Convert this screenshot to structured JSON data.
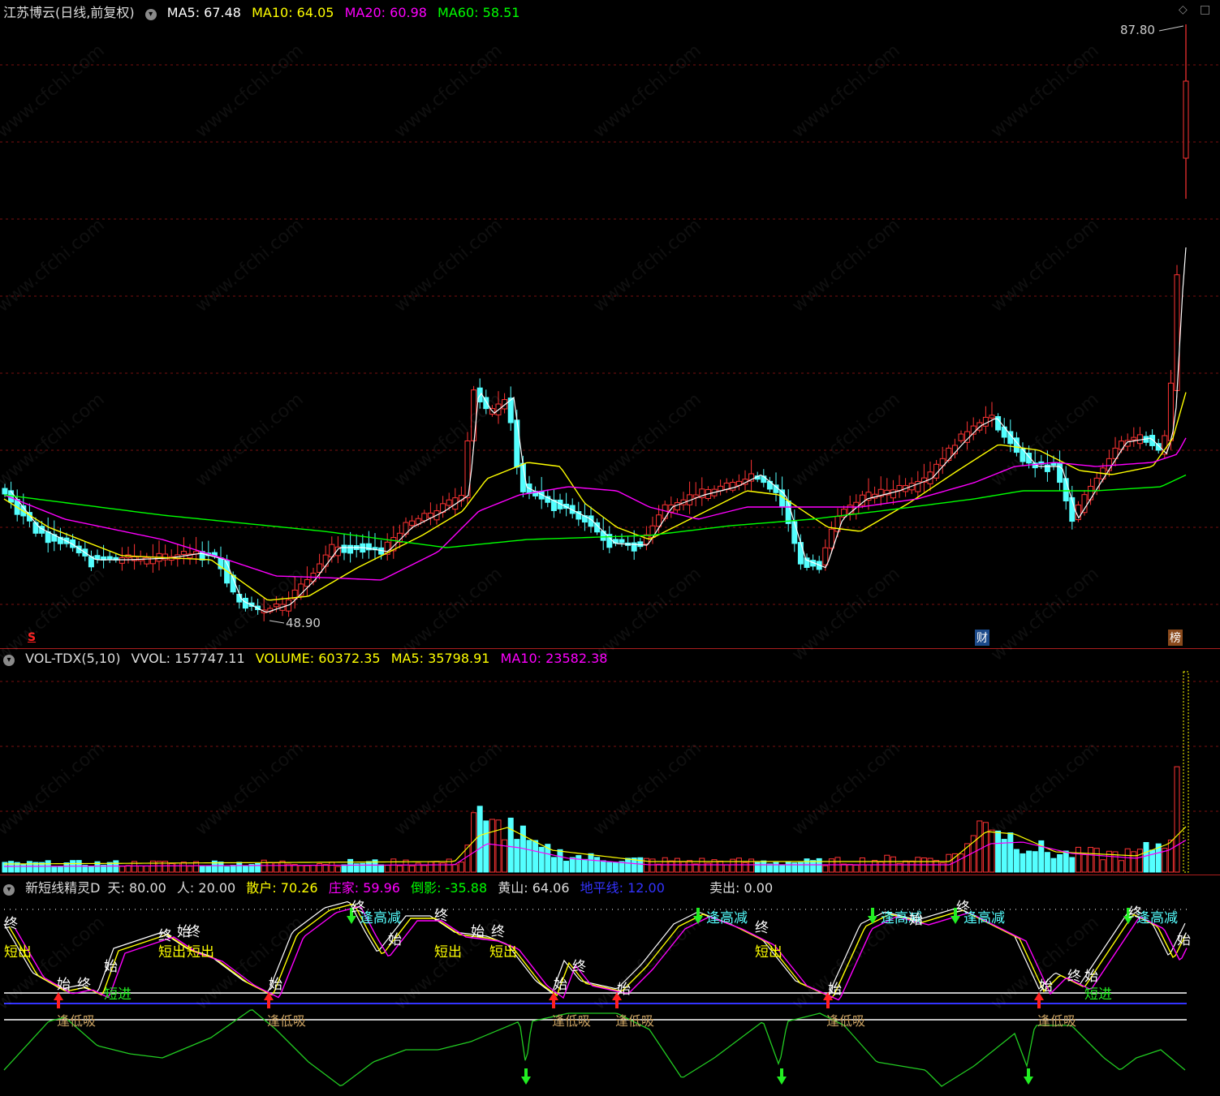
{
  "price_panel": {
    "title": "江苏博云(日线,前复权)",
    "ma": [
      {
        "label": "MA5: 67.48",
        "color": "#ffffff"
      },
      {
        "label": "MA10: 64.05",
        "color": "#ffff00"
      },
      {
        "label": "MA20: 60.98",
        "color": "#ff00ff"
      },
      {
        "label": "MA60: 58.51",
        "color": "#00ff00"
      }
    ],
    "high_label": "87.80",
    "low_label": "48.90",
    "marker_s": "S",
    "marker_cai": "财",
    "marker_bang": "榜"
  },
  "volume_panel": {
    "name": "VOL-TDX(5,10)",
    "items": [
      {
        "label": "VVOL: 157747.11",
        "color": "#dddddd"
      },
      {
        "label": "VOLUME: 60372.35",
        "color": "#ffff00"
      },
      {
        "label": "MA5: 35798.91",
        "color": "#ffff00"
      },
      {
        "label": "MA10: 23582.38",
        "color": "#ff00ff"
      }
    ]
  },
  "indicator_panel": {
    "name": "新短线精灵D",
    "items": [
      {
        "label": "天: 80.00",
        "color": "#dddddd"
      },
      {
        "label": "人: 20.00",
        "color": "#dddddd"
      },
      {
        "label": "散户: 70.26",
        "color": "#ffff00"
      },
      {
        "label": "庄家: 59.96",
        "color": "#ff00ff"
      },
      {
        "label": "倒影: -35.88",
        "color": "#00ff00"
      },
      {
        "label": "黄山: 64.06",
        "color": "#dddddd"
      },
      {
        "label": "地平线: 12.00",
        "color": "#3333ff"
      },
      {
        "label": "卖出: 0.00",
        "color": "#dddddd"
      }
    ],
    "signals": {
      "zhong": "终",
      "shi": "始",
      "duanchu": "短出",
      "duanjin": "短进",
      "fenggaojian": "逢高减",
      "fengdixi": "逢低吸"
    }
  },
  "watermark": "www.cfchi.com",
  "colors": {
    "up": "#ff3333",
    "down": "#54ffff",
    "ma5": "#ffffff",
    "ma10": "#ffff00",
    "ma20": "#ff00ff",
    "ma60": "#00ff00",
    "grid": "#7a1010"
  }
}
